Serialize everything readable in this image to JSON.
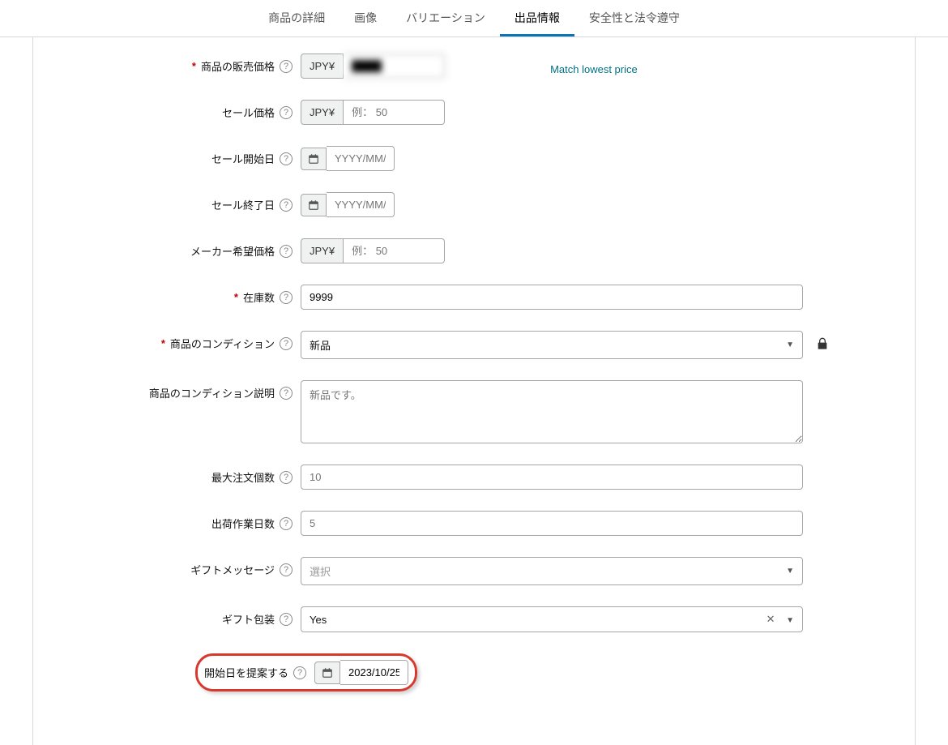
{
  "tabs": {
    "details": "商品の詳細",
    "images": "画像",
    "variations": "バリエーション",
    "offer": "出品情報",
    "safety": "安全性と法令遵守"
  },
  "labels": {
    "price": "商品の販売価格",
    "salePrice": "セール価格",
    "saleStart": "セール開始日",
    "saleEnd": "セール終了日",
    "msrp": "メーカー希望価格",
    "stock": "在庫数",
    "condition": "商品のコンディション",
    "conditionNote": "商品のコンディション説明",
    "maxOrder": "最大注文個数",
    "handlingDays": "出荷作業日数",
    "giftMessage": "ギフトメッセージ",
    "giftWrap": "ギフト包装",
    "proposeStart": "開始日を提案する"
  },
  "currencyPrefix": "JPY¥",
  "placeholders": {
    "ex50": "例： 50",
    "date": "YYYY/MM/DD",
    "conditionNote": "新品です。",
    "maxOrder": "10",
    "handlingDays": "5",
    "selectGeneric": "選択"
  },
  "values": {
    "price": "████",
    "stock": "9999",
    "condition": "新品",
    "giftWrap": "Yes",
    "proposeStart": "2023/10/25"
  },
  "linkText": "Match lowest price",
  "helpGlyph": "?"
}
